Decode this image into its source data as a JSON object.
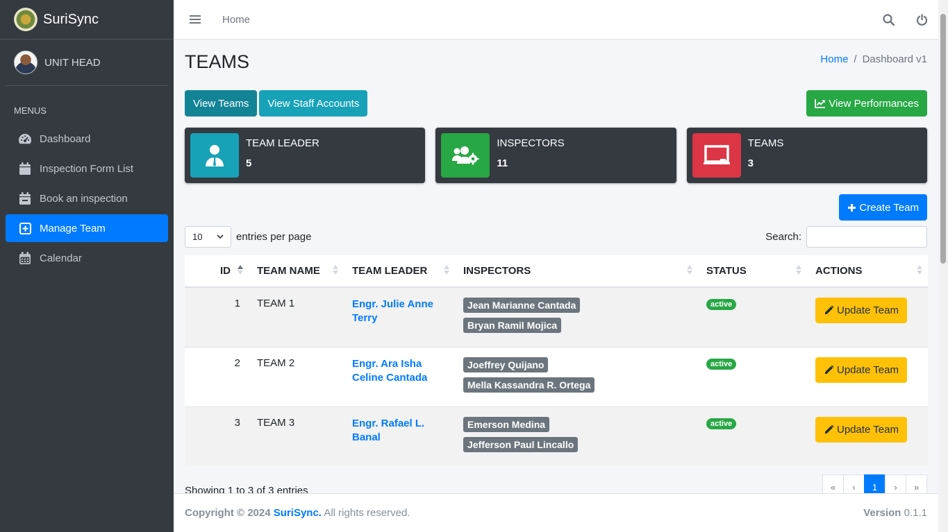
{
  "brand": {
    "name_light": "Suri",
    "name_bold": "Sync"
  },
  "user": {
    "name": "UNIT HEAD"
  },
  "sidebar": {
    "header": "MENUS",
    "items": [
      {
        "label": "Dashboard",
        "icon": "dashboard-gauge-icon"
      },
      {
        "label": "Inspection Form List",
        "icon": "calendar-icon"
      },
      {
        "label": "Book an inspection",
        "icon": "calendar-minus-icon"
      },
      {
        "label": "Manage Team",
        "icon": "plus-square-icon",
        "active": true
      },
      {
        "label": "Calendar",
        "icon": "calendar-grid-icon"
      }
    ]
  },
  "topnav": {
    "home": "Home"
  },
  "page": {
    "title": "TEAMS",
    "breadcrumb": {
      "home": "Home",
      "current": "Dashboard v1"
    }
  },
  "buttons": {
    "view_teams": "View Teams",
    "view_staff": "View Staff Accounts",
    "view_performances": "View Performances",
    "create_team": "Create Team",
    "update_team": "Update Team"
  },
  "info_boxes": [
    {
      "label": "TEAM LEADER",
      "value": "5",
      "color": "#17a2b8",
      "icon": "user-tie-icon"
    },
    {
      "label": "INSPECTORS",
      "value": "11",
      "color": "#28a745",
      "icon": "users-cog-icon"
    },
    {
      "label": "TEAMS",
      "value": "3",
      "color": "#dc3545",
      "icon": "chalkboard-icon"
    }
  ],
  "table_controls": {
    "entries_value": "10",
    "entries_label": "entries per page",
    "search_label": "Search:",
    "search_value": ""
  },
  "table": {
    "columns": [
      "ID",
      "TEAM NAME",
      "TEAM LEADER",
      "INSPECTORS",
      "STATUS",
      "ACTIONS"
    ],
    "rows": [
      {
        "id": "1",
        "team": "TEAM 1",
        "leader_line1": "Engr. Julie Anne",
        "leader_line2": "Terry",
        "inspectors": [
          "Jean Marianne Cantada",
          "Bryan Ramil Mojica"
        ],
        "status": "active"
      },
      {
        "id": "2",
        "team": "TEAM 2",
        "leader_line1": "Engr. Ara Isha",
        "leader_line2": "Celine Cantada",
        "inspectors": [
          "Joeffrey Quijano",
          "Mella Kassandra R. Ortega"
        ],
        "status": "active"
      },
      {
        "id": "3",
        "team": "TEAM 3",
        "leader_line1": "Engr. Rafael L.",
        "leader_line2": "Banal",
        "inspectors": [
          "Emerson Medina",
          "Jefferson Paul Lincallo"
        ],
        "status": "active"
      }
    ]
  },
  "pagination": {
    "info": "Showing 1 to 3 of 3 entries",
    "first": "«",
    "prev": "‹",
    "current": "1",
    "next": "›",
    "last": "»"
  },
  "footer": {
    "copyright": "Copyright © 2024",
    "brand": "SuriSync.",
    "rights": "All rights reserved.",
    "version_label": "Version",
    "version": "0.1.1"
  },
  "colors": {
    "accent": "#007bff",
    "sidebar": "#343a40"
  }
}
